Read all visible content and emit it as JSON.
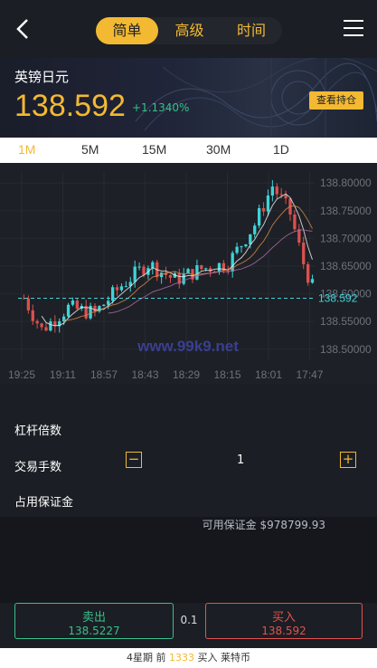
{
  "header": {
    "tabs": [
      {
        "label": "简单",
        "active": true
      },
      {
        "label": "高级",
        "active": false
      },
      {
        "label": "时间",
        "active": false
      }
    ]
  },
  "quote": {
    "pair": "英镑日元",
    "price": "138.592",
    "change": "+1.1340%",
    "hold_button": "查看持仓"
  },
  "timeframes": [
    {
      "label": "1M",
      "active": true
    },
    {
      "label": "5M",
      "active": false
    },
    {
      "label": "15M",
      "active": false
    },
    {
      "label": "30M",
      "active": false
    },
    {
      "label": "1D",
      "active": false
    }
  ],
  "chart_data": {
    "type": "candlestick",
    "y_ticks": [
      "138.80000",
      "138.75000",
      "138.70000",
      "138.65000",
      "138.60000",
      "138.55000",
      "138.50000"
    ],
    "x_ticks": [
      "19:25",
      "19:11",
      "18:57",
      "18:43",
      "18:29",
      "18:15",
      "18:01",
      "17:47"
    ],
    "last_price": "138.592",
    "watermark": "www.99k9.net",
    "ylim": [
      138.48,
      138.82
    ],
    "colors": {
      "up": "#3ed3d8",
      "down": "#d9514e",
      "ma1": "#f0f0f0",
      "ma2": "#d98a4a",
      "ma3": "#b06aa8"
    }
  },
  "form": {
    "leverage_label": "杠杆倍数",
    "lots_label": "交易手数",
    "lots_value": "1",
    "minus": "−",
    "plus": "+",
    "margin_label": "占用保证金",
    "available": "可用保证金 $978799.93"
  },
  "trade": {
    "sell_label": "卖出",
    "sell_price": "138.5227",
    "spread": "0.1",
    "buy_label": "买入",
    "buy_price": "138.592"
  },
  "footer": {
    "pre": "4星期 前",
    "count": "1333",
    "post": "买入 莱特币"
  }
}
